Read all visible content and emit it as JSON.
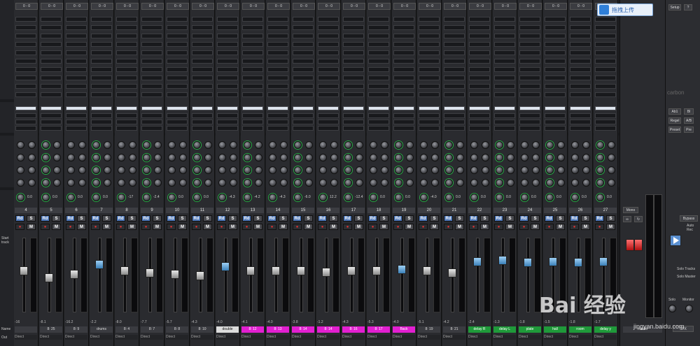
{
  "toolbar": {
    "upload_label": "拖拽上传",
    "setup_label": "Setup",
    "help_label": "?",
    "carbon_logo": "carbon"
  },
  "left_panel": {
    "start_track_label": "Start track",
    "names_label": "Name",
    "out_label": "Out"
  },
  "right_panel": {
    "bypass_label": "Bypass",
    "auto_label": "Auto Rec",
    "solo_tracks_label": "Solo Tracks",
    "solo_master_label": "Solo Master",
    "sfx_label": "SFX",
    "solo_knob_label": "Solo",
    "monitor_knob_label": "Monitor",
    "ab_labels": [
      "Ab1",
      "Bl",
      "Regel",
      "A/B",
      "Preset",
      "Pre"
    ]
  },
  "master": {
    "name": "master",
    "mode_label": "Mono",
    "icons": [
      "link-icon",
      "loop-icon"
    ]
  },
  "strips": [
    {
      "num": "4",
      "fader": 0.55,
      "cap": "white",
      "name": "",
      "name_style": "",
      "out": "Direct",
      "vol": "-16",
      "pan": "0.0"
    },
    {
      "num": "5",
      "fader": 0.45,
      "cap": "white",
      "name": "8: 25",
      "name_style": "",
      "out": "Direct",
      "vol": "-8.1",
      "pan": "0.0"
    },
    {
      "num": "6",
      "fader": 0.5,
      "cap": "white",
      "name": "8: 9",
      "name_style": "",
      "out": "Direct",
      "vol": "-16.2",
      "pan": "0.0"
    },
    {
      "num": "7",
      "fader": 0.65,
      "cap": "blue",
      "name": "drums",
      "name_style": "",
      "out": "Direct",
      "vol": "-2.2",
      "pan": "0.0"
    },
    {
      "num": "8",
      "fader": 0.55,
      "cap": "white",
      "name": "8: 4",
      "name_style": "",
      "out": "Direct",
      "vol": "-8.0",
      "pan": "-17"
    },
    {
      "num": "9",
      "fader": 0.52,
      "cap": "white",
      "name": "8: 7",
      "name_style": "",
      "out": "Direct",
      "vol": "-7.7",
      "pan": "-2.4"
    },
    {
      "num": "10",
      "fader": 0.5,
      "cap": "white",
      "name": "8: 8",
      "name_style": "",
      "out": "Direct",
      "vol": "-5.7",
      "pan": "0.0"
    },
    {
      "num": "11",
      "fader": 0.48,
      "cap": "white",
      "name": "8: 10",
      "name_style": "",
      "out": "Direct",
      "vol": "-4.3",
      "pan": "0.0"
    },
    {
      "num": "12",
      "fader": 0.62,
      "cap": "blue",
      "name": "double",
      "name_style": "white",
      "out": "Direct",
      "vol": "-4.0",
      "pan": "-4.3"
    },
    {
      "num": "13",
      "fader": 0.55,
      "cap": "white",
      "name": "8: 12",
      "name_style": "pink",
      "out": "Direct",
      "vol": "-4.1",
      "pan": "-4.2"
    },
    {
      "num": "14",
      "fader": 0.55,
      "cap": "white",
      "name": "8: 13",
      "name_style": "pink",
      "out": "Direct",
      "vol": "-4.0",
      "pan": "-4.3"
    },
    {
      "num": "15",
      "fader": 0.55,
      "cap": "white",
      "name": "8: 14",
      "name_style": "pink",
      "out": "Direct",
      "vol": "-3.8",
      "pan": "-6.0"
    },
    {
      "num": "16",
      "fader": 0.53,
      "cap": "white",
      "name": "8: 14",
      "name_style": "pink",
      "out": "Direct",
      "vol": "-1.2",
      "pan": "12.2"
    },
    {
      "num": "17",
      "fader": 0.55,
      "cap": "white",
      "name": "8: 16",
      "name_style": "pink",
      "out": "Direct",
      "vol": "-4.3",
      "pan": "-12.4"
    },
    {
      "num": "18",
      "fader": 0.55,
      "cap": "white",
      "name": "8: 17",
      "name_style": "pink",
      "out": "Direct",
      "vol": "-5.3",
      "pan": "0.0"
    },
    {
      "num": "19",
      "fader": 0.58,
      "cap": "blue",
      "name": "Back",
      "name_style": "pink",
      "out": "Direct",
      "vol": "-4.0",
      "pan": "0.0"
    },
    {
      "num": "20",
      "fader": 0.55,
      "cap": "white",
      "name": "8: 19",
      "name_style": "",
      "out": "Direct",
      "vol": "-5.1",
      "pan": "-4.0"
    },
    {
      "num": "21",
      "fader": 0.52,
      "cap": "white",
      "name": "8: 21",
      "name_style": "",
      "out": "Direct",
      "vol": "-4.2",
      "pan": "0.0"
    },
    {
      "num": "22",
      "fader": 0.7,
      "cap": "blue",
      "name": "delay R",
      "name_style": "green",
      "out": "Direct",
      "vol": "-2.4",
      "pan": "0.0"
    },
    {
      "num": "23",
      "fader": 0.72,
      "cap": "blue",
      "name": "delay L",
      "name_style": "green",
      "out": "Direct",
      "vol": "-1.3",
      "pan": "0.0"
    },
    {
      "num": "24",
      "fader": 0.68,
      "cap": "blue",
      "name": "plate",
      "name_style": "green",
      "out": "Direct",
      "vol": "-1.8",
      "pan": "0.0"
    },
    {
      "num": "25",
      "fader": 0.7,
      "cap": "blue",
      "name": "hall",
      "name_style": "green",
      "out": "Direct",
      "vol": "-1.5",
      "pan": "0.0"
    },
    {
      "num": "26",
      "fader": 0.68,
      "cap": "blue",
      "name": "room",
      "name_style": "green",
      "out": "Direct",
      "vol": "-1.8",
      "pan": "0.0"
    },
    {
      "num": "27",
      "fader": 0.7,
      "cap": "blue",
      "name": "delay y",
      "name_style": "green",
      "out": "Direct",
      "vol": "-1.7",
      "pan": "0.0"
    }
  ],
  "buttons": {
    "mute": "M",
    "solo": "S",
    "read": "Rd"
  },
  "watermark": {
    "text": "Bai 经验",
    "sub": "jingyan.baidu.com"
  }
}
